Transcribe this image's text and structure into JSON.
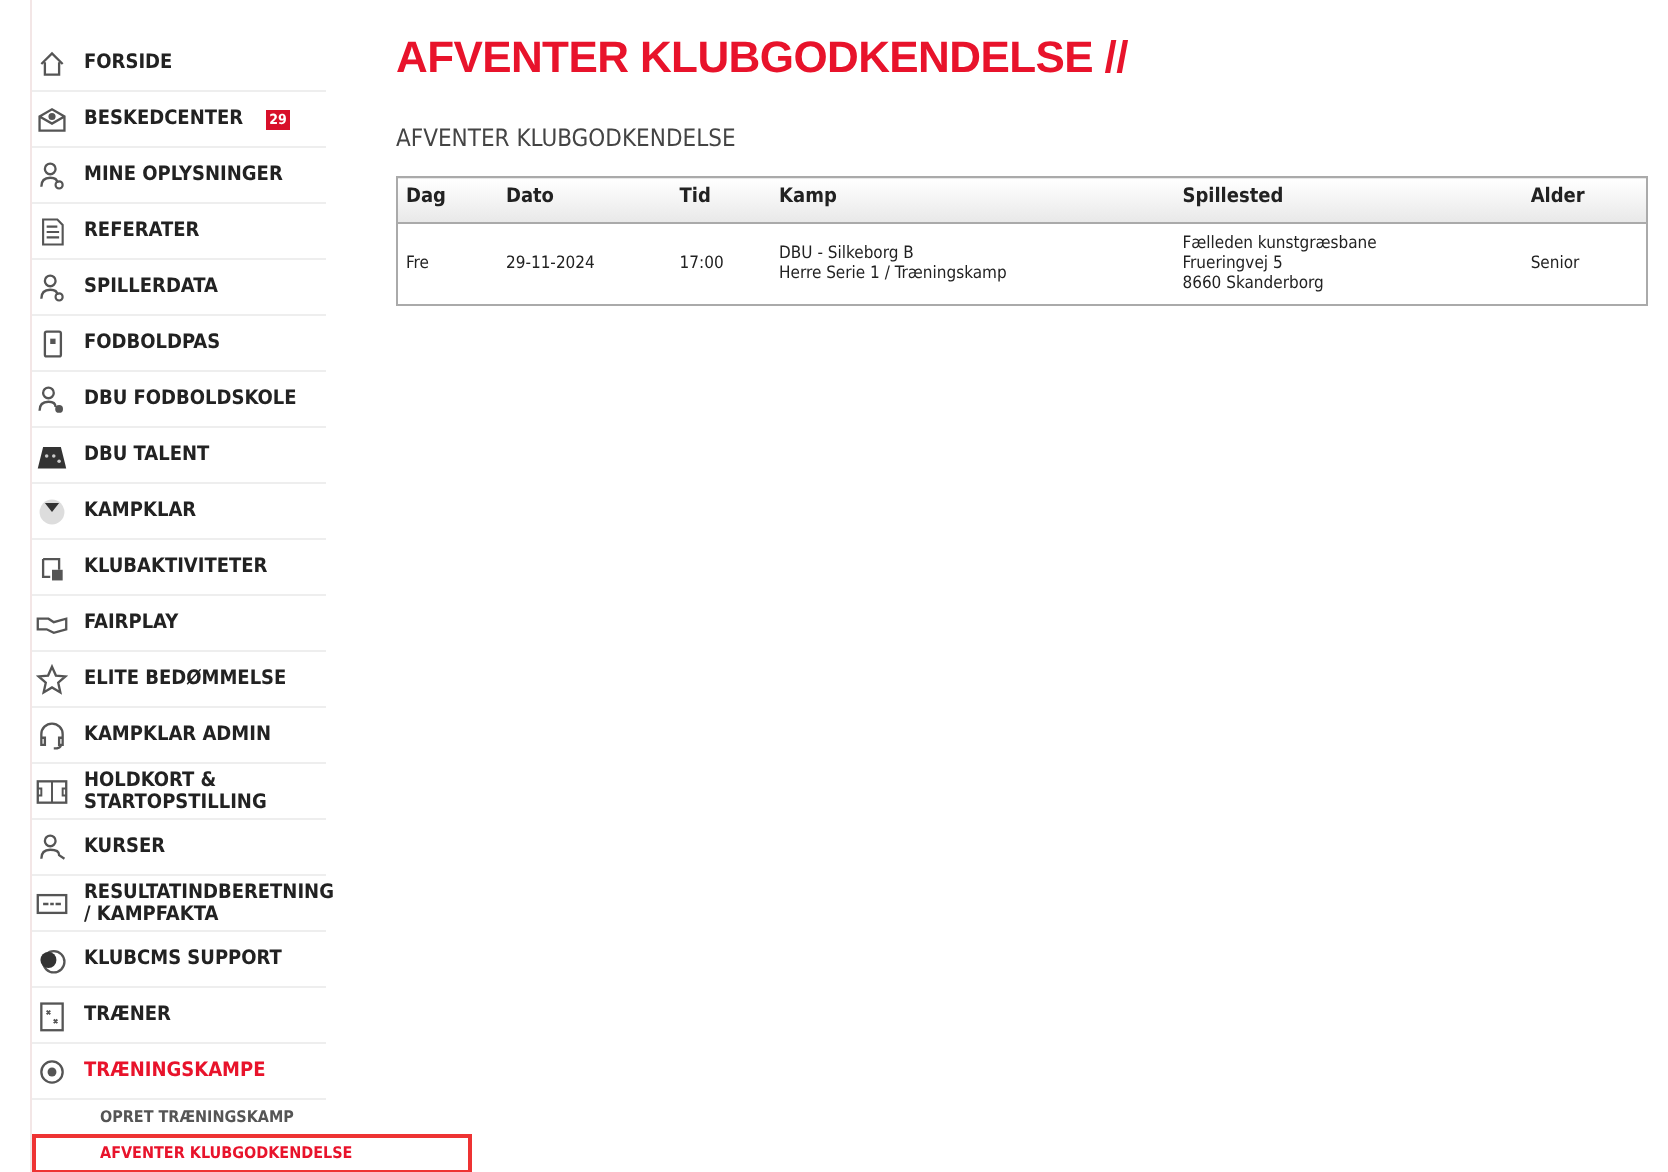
{
  "menu": [
    {
      "label": "FORSIDE",
      "selected": false
    },
    {
      "label": "BESKEDCENTER",
      "badge": "29",
      "selected": false
    },
    {
      "label": "MINE OPLYSNINGER",
      "selected": false
    },
    {
      "label": "REFERATER",
      "selected": false
    },
    {
      "label": "SPILLERDATA",
      "selected": false
    },
    {
      "label": "FODBOLDPAS",
      "selected": false
    },
    {
      "label": "DBU FODBOLDSKOLE",
      "selected": false
    },
    {
      "label": "DBU TALENT",
      "selected": false
    },
    {
      "label": "KAMPKLAR",
      "selected": false
    },
    {
      "label": "KLUBAKTIVITETER",
      "selected": false
    },
    {
      "label": "FAIRPLAY",
      "selected": false
    },
    {
      "label": "ELITE BEDØMMELSE",
      "selected": false
    },
    {
      "label": "KAMPKLAR ADMIN",
      "selected": false
    },
    {
      "label": "HOLDKORT & STARTOPSTILLING",
      "selected": false
    },
    {
      "label": "KURSER",
      "selected": false
    },
    {
      "label": "RESULTATINDBERETNING / KAMPFAKTA",
      "selected": false
    },
    {
      "label": "KLUBCMS SUPPORT",
      "selected": false
    },
    {
      "label": "TRÆNER",
      "selected": false
    },
    {
      "label": "TRÆNINGSKAMPE",
      "selected": true,
      "children": [
        {
          "label": "OPRET TRÆNINGSKAMP",
          "selected": false
        },
        {
          "label": "AFVENTER KLUBGODKENDELSE",
          "selected": true
        }
      ]
    }
  ],
  "page_title": "AFVENTER KLUBGODKENDELSE //",
  "section_title": "AFVENTER KLUBGODKENDELSE",
  "table": {
    "columns": [
      "Dag",
      "Dato",
      "Tid",
      "Kamp",
      "Spillested",
      "Alder"
    ],
    "rows": [
      {
        "cells": [
          [
            "Fre"
          ],
          [
            "29-11-2024"
          ],
          [
            "17:00"
          ],
          [
            "DBU - Silkeborg B",
            "Herre Serie 1 / Træningskamp"
          ],
          [
            "Fælleden kunstgræsbane",
            "Frueringvej 5",
            "8660 Skanderborg"
          ],
          [
            "Senior"
          ]
        ]
      }
    ]
  }
}
